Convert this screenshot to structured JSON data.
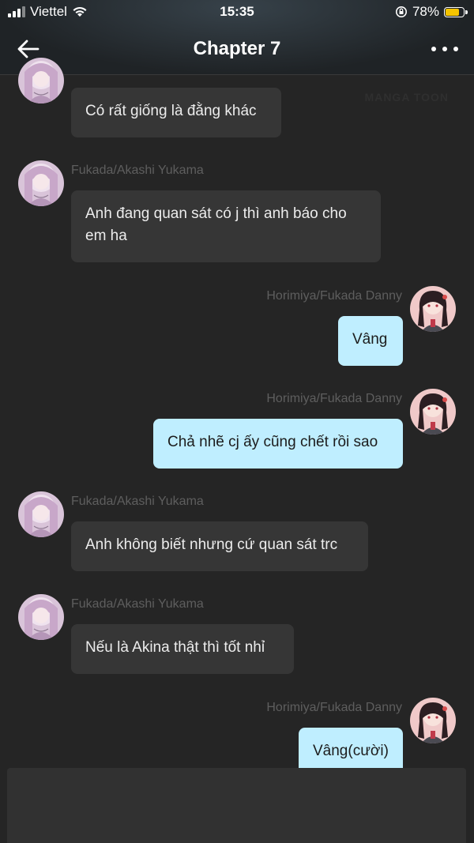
{
  "status_bar": {
    "carrier": "Viettel",
    "time": "15:35",
    "battery": "78%",
    "battery_level": 0.78
  },
  "header": {
    "title": "Chapter 7"
  },
  "watermark": "MANGA TOON",
  "messages": [
    {
      "side": "left",
      "sender": "",
      "text": "Có rất giống là đằng khác"
    },
    {
      "side": "left",
      "sender": "Fukada/Akashi Yukama",
      "text": "Anh đang quan sát có j thì anh báo cho em ha"
    },
    {
      "side": "right",
      "sender": "Horimiya/Fukada Danny",
      "text": "Vâng"
    },
    {
      "side": "right",
      "sender": "Horimiya/Fukada Danny",
      "text": "Chả nhẽ cj ấy cũng chết rồi sao"
    },
    {
      "side": "left",
      "sender": "Fukada/Akashi Yukama",
      "text": "Anh không biết nhưng cứ quan sát trc"
    },
    {
      "side": "left",
      "sender": "Fukada/Akashi Yukama",
      "text": "Nếu là Akina thật thì tốt nhỉ"
    },
    {
      "side": "right",
      "sender": "Horimiya/Fukada Danny",
      "text": "Vâng(cười)"
    }
  ],
  "colors": {
    "background": "#252525",
    "left_bubble": "#363636",
    "right_bubble": "#bfeeff",
    "battery": "#f5c400"
  }
}
